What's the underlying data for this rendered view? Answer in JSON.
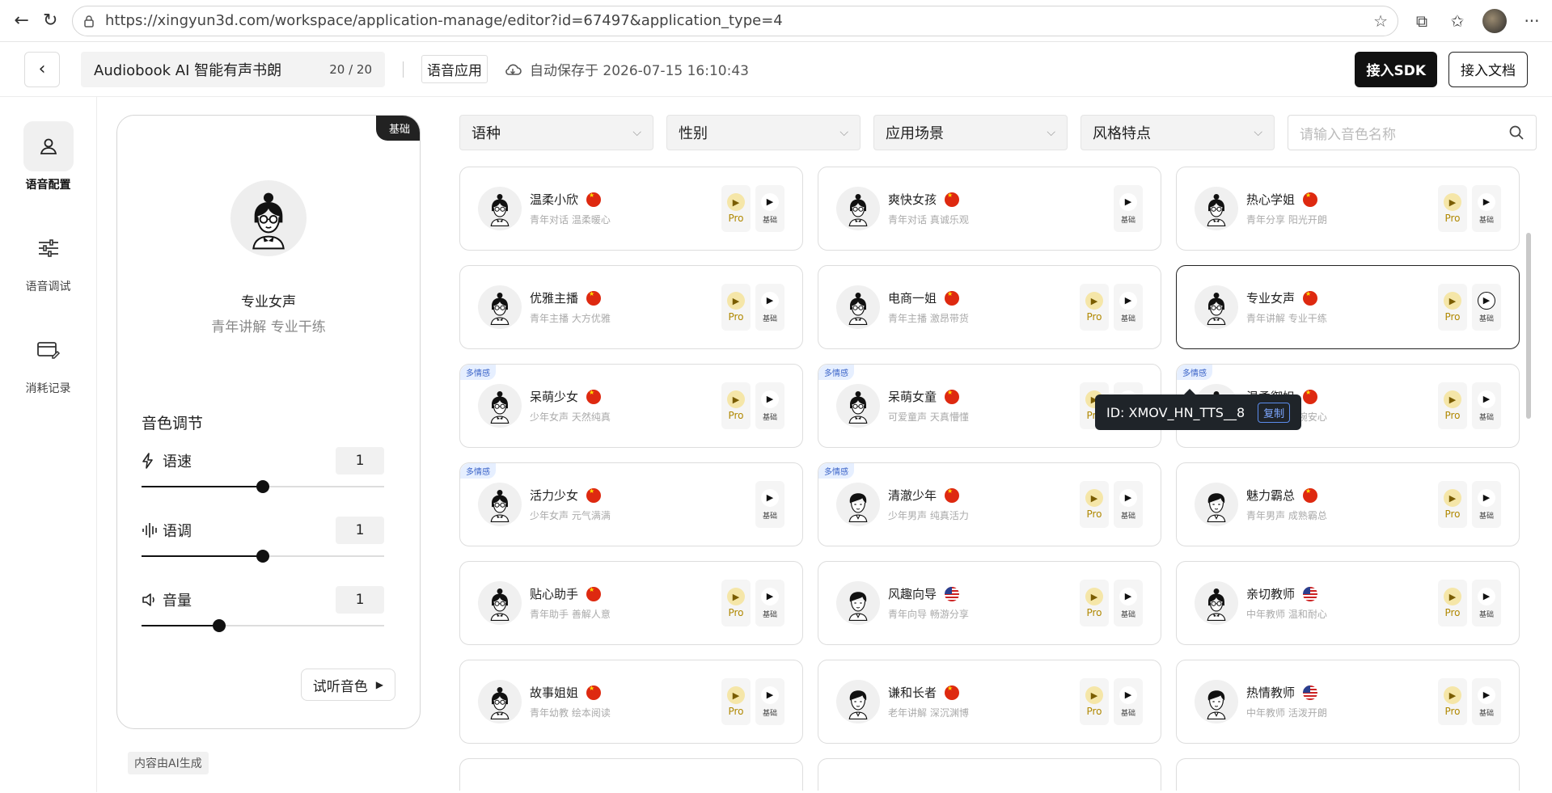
{
  "browser": {
    "url": "https://xingyun3d.com/workspace/application-manage/editor?id=67497&application_type=4"
  },
  "header": {
    "title": "Audiobook AI 智能有声书朗",
    "title_count": "20 / 20",
    "app_type": "语音应用",
    "autosave": "自动保存于 2026-07-15 16:10:43",
    "sdk_btn": "接入SDK",
    "docs_btn": "接入文档"
  },
  "sidebar": {
    "items": [
      {
        "label": "语音配置"
      },
      {
        "label": "语音调试"
      },
      {
        "label": "消耗记录"
      }
    ]
  },
  "config": {
    "badge": "基础",
    "voice_name": "专业女声",
    "voice_desc": "青年讲解 专业干练",
    "adjust_title": "音色调节",
    "sliders": [
      {
        "label": "语速",
        "value": "1",
        "level": 0.5
      },
      {
        "label": "语调",
        "value": "1",
        "level": 0.5
      },
      {
        "label": "音量",
        "value": "1",
        "level": 0.32
      }
    ],
    "listen_btn": "试听音色",
    "ai_note": "内容由AI生成"
  },
  "filters": {
    "items": [
      {
        "label": "语种"
      },
      {
        "label": "性别"
      },
      {
        "label": "应用场景"
      },
      {
        "label": "风格特点"
      }
    ],
    "search_placeholder": "请输入音色名称"
  },
  "play_labels": {
    "pro": "Pro",
    "basic": "基础"
  },
  "voices": [
    {
      "name": "温柔小欣",
      "desc": "青年对话 温柔暖心",
      "flag": "cn",
      "gender": "f",
      "pro": true,
      "multi": false
    },
    {
      "name": "爽快女孩",
      "desc": "青年对话 真诚乐观",
      "flag": "cn",
      "gender": "f",
      "pro": false,
      "multi": false
    },
    {
      "name": "热心学姐",
      "desc": "青年分享 阳光开朗",
      "flag": "cn",
      "gender": "f",
      "pro": true,
      "multi": false
    },
    {
      "name": "优雅主播",
      "desc": "青年主播 大方优雅",
      "flag": "cn",
      "gender": "f",
      "pro": true,
      "multi": false
    },
    {
      "name": "电商一姐",
      "desc": "青年主播 激昂带货",
      "flag": "cn",
      "gender": "f",
      "pro": true,
      "multi": false
    },
    {
      "name": "专业女声",
      "desc": "青年讲解 专业干练",
      "flag": "cn",
      "gender": "f",
      "pro": true,
      "multi": false,
      "selected": true
    },
    {
      "name": "呆萌少女",
      "desc": "少年女声 天然纯真",
      "flag": "cn",
      "gender": "f",
      "pro": true,
      "multi": true
    },
    {
      "name": "呆萌女童",
      "desc": "可爱童声 天真懵懂",
      "flag": "cn",
      "gender": "f",
      "pro": true,
      "multi": true
    },
    {
      "name": "温柔御姐",
      "desc": "青年女声 温婉安心",
      "flag": "cn",
      "gender": "f",
      "pro": true,
      "multi": true
    },
    {
      "name": "活力少女",
      "desc": "少年女声 元气满满",
      "flag": "cn",
      "gender": "f",
      "pro": false,
      "multi": true
    },
    {
      "name": "清澈少年",
      "desc": "少年男声 纯真活力",
      "flag": "cn",
      "gender": "m",
      "pro": true,
      "multi": true
    },
    {
      "name": "魅力霸总",
      "desc": "青年男声 成熟霸总",
      "flag": "cn",
      "gender": "m",
      "pro": true,
      "multi": false
    },
    {
      "name": "贴心助手",
      "desc": "青年助手 善解人意",
      "flag": "cn",
      "gender": "f",
      "pro": true,
      "multi": false
    },
    {
      "name": "风趣向导",
      "desc": "青年向导 畅游分享",
      "flag": "us",
      "gender": "m",
      "pro": true,
      "multi": false
    },
    {
      "name": "亲切教师",
      "desc": "中年教师 温和耐心",
      "flag": "us",
      "gender": "f",
      "pro": true,
      "multi": false
    },
    {
      "name": "故事姐姐",
      "desc": "青年幼教 绘本阅读",
      "flag": "cn",
      "gender": "f",
      "pro": true,
      "multi": false
    },
    {
      "name": "谦和长者",
      "desc": "老年讲解 深沉渊博",
      "flag": "cn",
      "gender": "m",
      "pro": true,
      "multi": false
    },
    {
      "name": "热情教师",
      "desc": "中年教师 活泼开朗",
      "flag": "us",
      "gender": "m",
      "pro": true,
      "multi": false
    }
  ],
  "multi_badge": "多情感",
  "tooltip": {
    "id_text": "ID: XMOV_HN_TTS__8",
    "copy": "复制"
  }
}
